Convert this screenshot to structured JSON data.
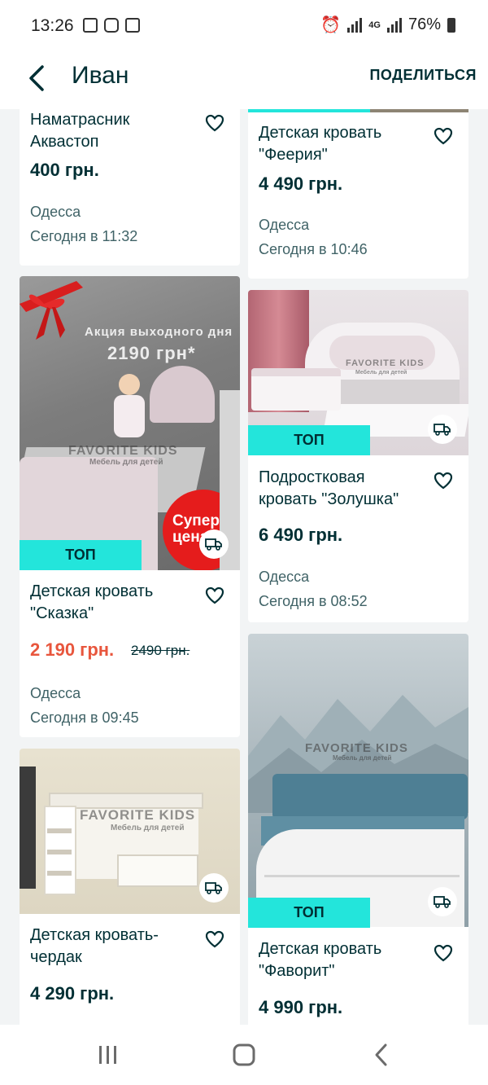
{
  "status_bar": {
    "time": "13:26",
    "network": "4G",
    "battery": "76%"
  },
  "header": {
    "title": "Иван",
    "share_label": "ПОДЕЛИТЬСЯ"
  },
  "colors": {
    "accent": "#23e5db",
    "text": "#002f34",
    "sale": "#e8563d",
    "background": "#f2f4f5"
  },
  "listings": [
    {
      "title": "Наматрасник Аквастоп",
      "price": "400 грн.",
      "city": "Одесса",
      "date": "Сегодня в 11:32"
    },
    {
      "title": "Детская кровать \"Феерия\"",
      "price": "4 490 грн.",
      "city": "Одесса",
      "date": "Сегодня в 10:46"
    },
    {
      "title": "Детская кровать \"Сказка\"",
      "price": "2 190 грн.",
      "old_price": "2490 грн.",
      "city": "Одесса",
      "date": "Сегодня в 09:45",
      "badge": "ТОП",
      "image_text": {
        "promo": "Акция выходного дня",
        "promo_price": "2190 грн*",
        "brand": "FAVORITE KIDS",
        "tagline": "Мебель для детей",
        "sticker": "Супер цена"
      }
    },
    {
      "title": "Подростковая кровать \"Золушка\"",
      "price": "6 490 грн.",
      "city": "Одесса",
      "date": "Сегодня в 08:52",
      "badge": "ТОП",
      "image_text": {
        "brand": "FAVORITE KIDS",
        "tagline": "Мебель для детей"
      }
    },
    {
      "title": "Детская кровать-чердак",
      "price": "4 290 грн.",
      "image_text": {
        "brand": "FAVORITE KIDS",
        "tagline": "Мебель для детей"
      }
    },
    {
      "title": "Детская кровать \"Фаворит\"",
      "price": "4 990 грн.",
      "badge": "ТОП",
      "image_text": {
        "brand": "FAVORITE KIDS",
        "tagline": "Мебель для детей"
      }
    }
  ]
}
